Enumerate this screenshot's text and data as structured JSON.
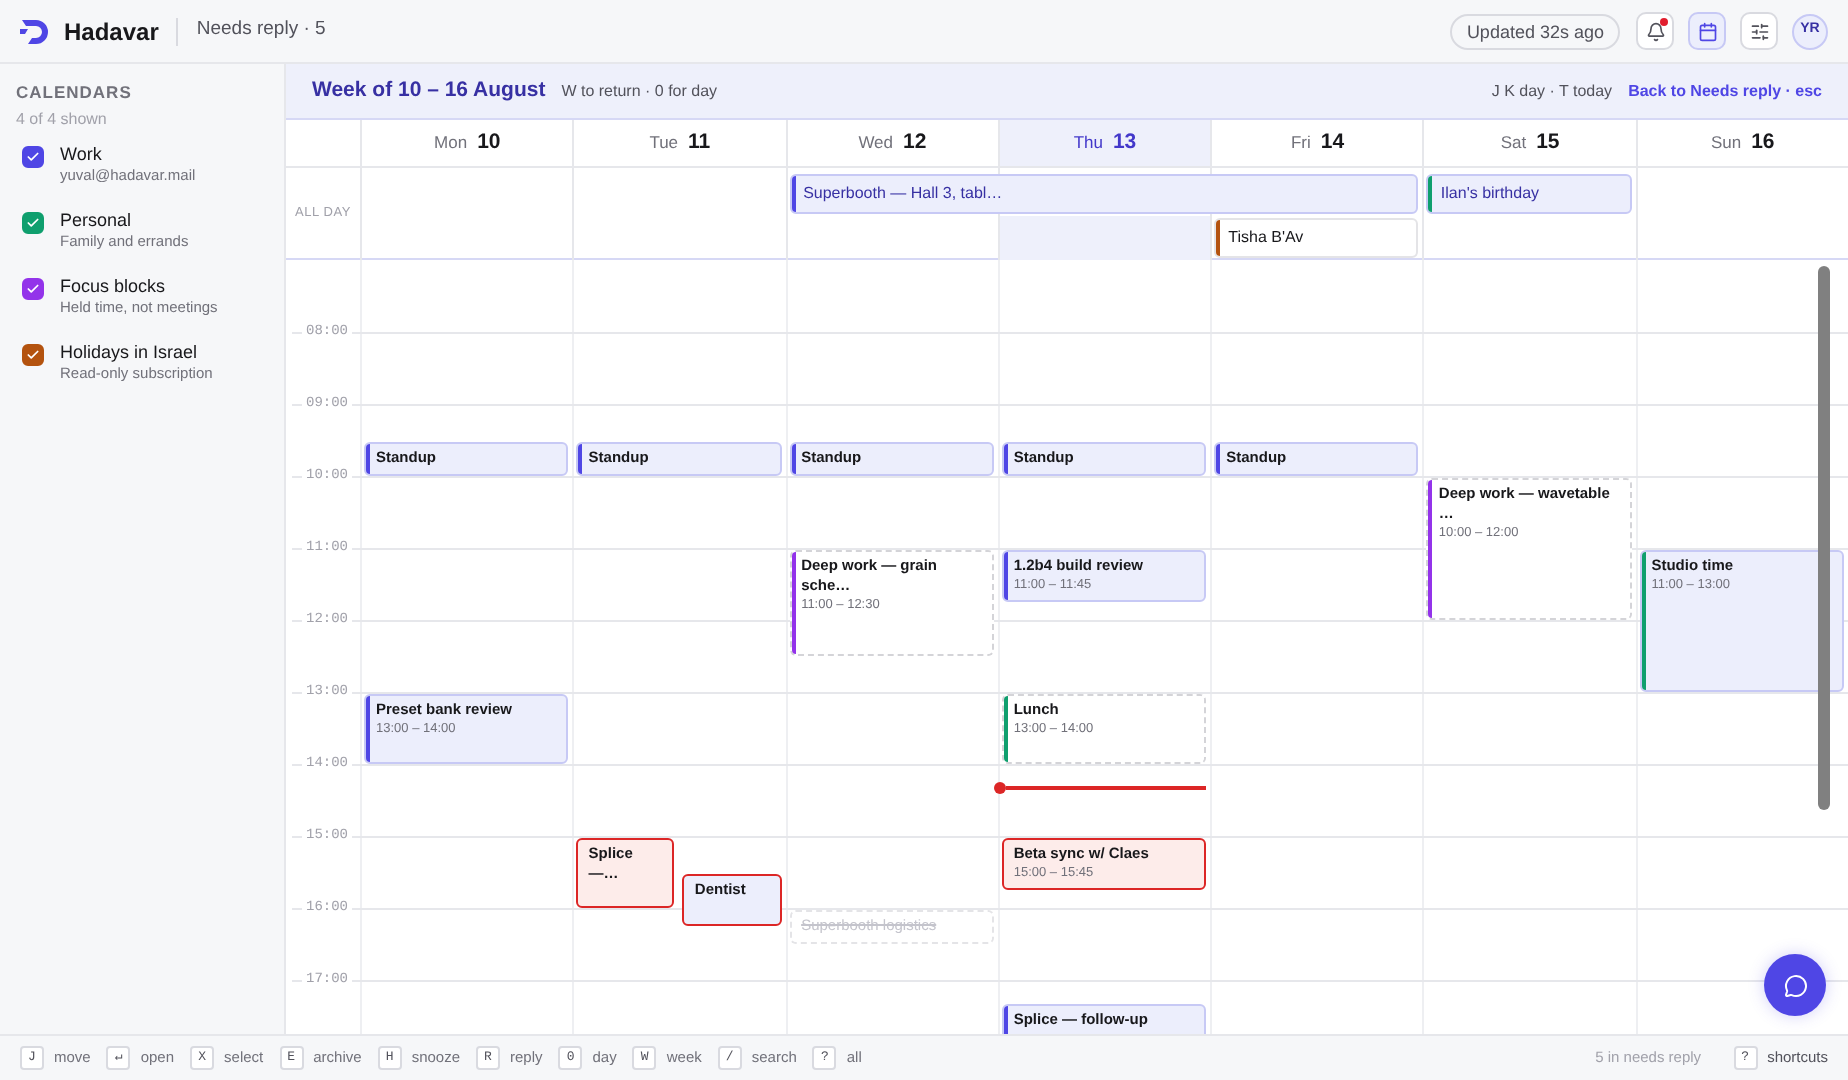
{
  "app": {
    "name": "Hadavar",
    "inbox_label": "Needs reply · 5"
  },
  "topbar": {
    "updated": "Updated 32s ago",
    "notifications_unread": true,
    "calendar_view_active": true,
    "avatar": "YR"
  },
  "sidebar": {
    "title": "CALENDARS",
    "subtitle": "4 of 4 shown",
    "calendars": [
      {
        "name": "Work",
        "detail": "yuval@hadavar.mail",
        "color": "#4f46e5",
        "checked": true
      },
      {
        "name": "Personal",
        "detail": "Family and errands",
        "color": "#0f9f6e",
        "checked": true
      },
      {
        "name": "Focus blocks",
        "detail": "Held time, not meetings",
        "color": "#9333ea",
        "checked": true
      },
      {
        "name": "Holidays in Israel",
        "detail": "Read-only subscription",
        "color": "#b4530f",
        "checked": true
      }
    ]
  },
  "week": {
    "title": "Week of 10 – 16 August",
    "hint": "W to return · 0 for day",
    "shortcuts": "J K day · T today",
    "back_link": "Back to Needs reply · esc"
  },
  "allday_label": "ALL DAY",
  "hours": [
    "08:00",
    "09:00",
    "10:00",
    "11:00",
    "12:00",
    "13:00",
    "14:00",
    "15:00",
    "16:00",
    "17:00"
  ],
  "days": [
    {
      "weekday": "Mon",
      "date": "10",
      "selected": false,
      "events": [
        {
          "title": "Standup",
          "color": "#4f46e5",
          "kind": "confirmed",
          "conflict": false
        },
        {
          "title": "Preset bank review",
          "time": "13:00 – 14:00",
          "color": "#4f46e5",
          "kind": "confirmed",
          "conflict": false
        }
      ]
    },
    {
      "weekday": "Tue",
      "date": "11",
      "selected": false,
      "events": [
        {
          "title": "Standup",
          "color": "#4f46e5",
          "kind": "confirmed",
          "conflict": false
        },
        {
          "title": "Splice —…",
          "kind": "pending",
          "conflict": true
        },
        {
          "title": "Dentist",
          "kind": "confirmed",
          "conflict": true
        }
      ]
    },
    {
      "weekday": "Wed",
      "date": "12",
      "selected": false,
      "allday": [
        {
          "title": "Superbooth — Hall 3, tabl…",
          "color": "#4f46e5",
          "kind": "confirmed"
        }
      ],
      "events": [
        {
          "title": "Standup",
          "color": "#4f46e5",
          "kind": "confirmed",
          "conflict": false
        },
        {
          "title": "Deep work — grain sche…",
          "time": "11:00 – 12:30",
          "color": "#9333ea",
          "kind": "tentative",
          "conflict": false
        },
        {
          "title": "Superbooth logistics",
          "kind": "declined"
        }
      ]
    },
    {
      "weekday": "Thu",
      "date": "13",
      "selected": true,
      "events": [
        {
          "title": "Standup",
          "color": "#4f46e5",
          "kind": "confirmed",
          "conflict": false
        },
        {
          "title": "1.2b4 build review",
          "time": "11:00 – 11:45",
          "color": "#4f46e5",
          "kind": "confirmed",
          "conflict": false
        },
        {
          "title": "Lunch",
          "time": "13:00 – 14:00",
          "color": "#0f9f6e",
          "kind": "tentative",
          "conflict": false
        },
        {
          "title": "Beta sync w/ Claes",
          "time": "15:00 – 15:45",
          "kind": "pending",
          "conflict": true
        },
        {
          "title": "Splice — follow-up",
          "color": "#4f46e5",
          "kind": "confirmed",
          "conflict": false
        }
      ]
    },
    {
      "weekday": "Fri",
      "date": "14",
      "selected": false,
      "allday": [
        {
          "title": "Tisha B'Av",
          "color": "#b4530f",
          "kind": "holiday"
        }
      ],
      "events": [
        {
          "title": "Standup",
          "color": "#4f46e5",
          "kind": "confirmed",
          "conflict": false
        }
      ]
    },
    {
      "weekday": "Sat",
      "date": "15",
      "selected": false,
      "allday": [
        {
          "title": "Ilan's birthday",
          "color": "#0f9f6e",
          "kind": "confirmed"
        }
      ],
      "events": [
        {
          "title": "Deep work — wavetable …",
          "time": "10:00 – 12:00",
          "color": "#9333ea",
          "kind": "tentative",
          "conflict": false
        }
      ]
    },
    {
      "weekday": "Sun",
      "date": "16",
      "selected": false,
      "events": [
        {
          "title": "Studio time",
          "time": "11:00 – 13:00",
          "color": "#0f9f6e",
          "kind": "confirmed",
          "conflict": false
        }
      ]
    }
  ],
  "footer": {
    "keys": [
      {
        "key": "J",
        "label": "move"
      },
      {
        "key": "↵",
        "label": "open"
      },
      {
        "key": "X",
        "label": "select"
      },
      {
        "key": "E",
        "label": "archive"
      },
      {
        "key": "H",
        "label": "snooze"
      },
      {
        "key": "R",
        "label": "reply"
      },
      {
        "key": "0",
        "label": "day"
      },
      {
        "key": "W",
        "label": "week"
      },
      {
        "key": "/",
        "label": "search"
      },
      {
        "key": "?",
        "label": "all"
      }
    ],
    "count": "5 in needs reply",
    "help_key": "?",
    "help_label": "shortcuts"
  }
}
